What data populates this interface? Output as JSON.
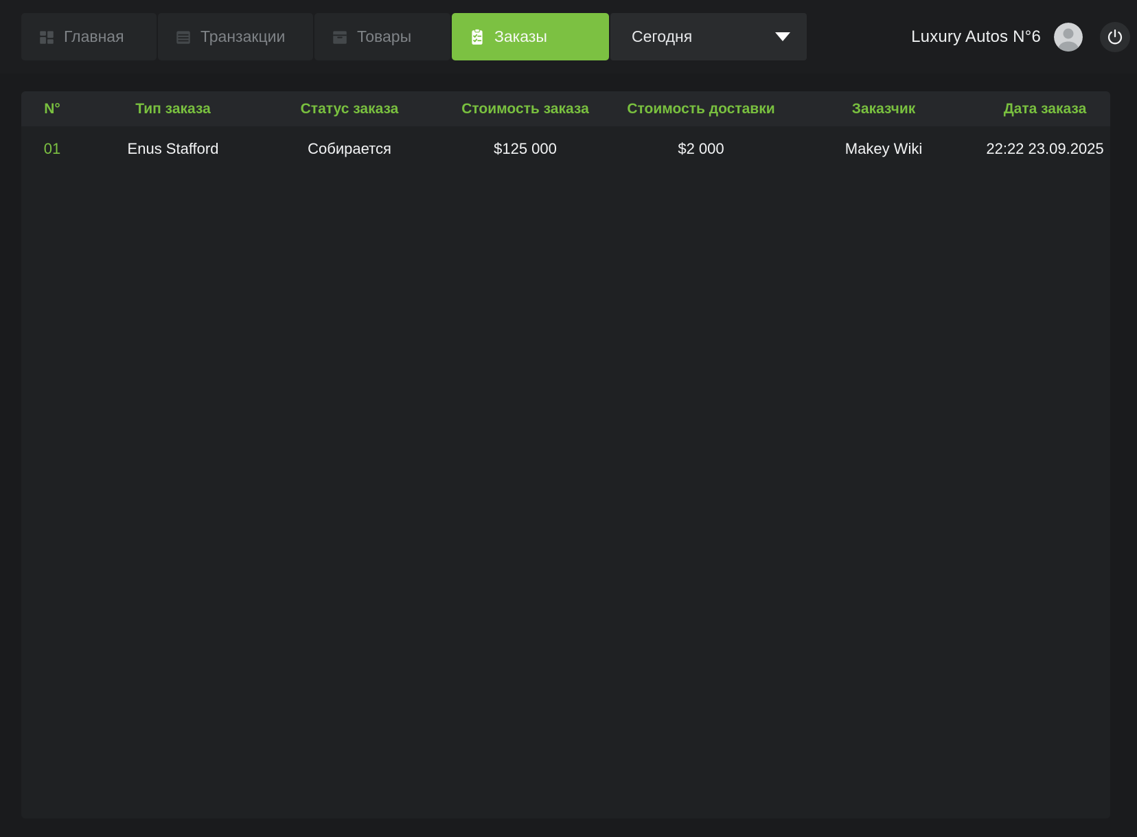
{
  "navbar": {
    "business_name": "Luxury Autos N°6",
    "tabs": [
      {
        "label": "Главная",
        "icon": "dashboard-icon",
        "active": false
      },
      {
        "label": "Транзакции",
        "icon": "transactions-icon",
        "active": false
      },
      {
        "label": "Товары",
        "icon": "goods-box-icon",
        "active": false
      },
      {
        "label": "Заказы",
        "icon": "orders-clipboard-icon",
        "active": true
      }
    ],
    "period_dropdown": {
      "value": "Сегодня",
      "icon": "chevron-down-icon"
    },
    "icons": {
      "avatar": "user-avatar",
      "power": "power-icon"
    }
  },
  "table": {
    "columns": [
      "N°",
      "Тип заказа",
      "Статус заказа",
      "Стоимость заказа",
      "Стоимость доставки",
      "Заказчик",
      "Дата заказа"
    ],
    "rows": [
      {
        "number": "01",
        "order_type": "Enus Stafford",
        "status": "Собирается",
        "order_cost": "$125 000",
        "delivery_cost": "$2 000",
        "customer": "Makey Wiki",
        "date": "22:22 23.09.2025"
      }
    ]
  },
  "colors": {
    "accent_green": "#7cc142",
    "header_text_green": "#79c03f",
    "page_bg": "#1a1b1d",
    "navbar_bg": "#1c1d1f",
    "tab_bg": "#242628",
    "dropdown_bg": "#2a2c2e",
    "panel_bg": "#1f2123",
    "table_header_bg": "#26282b",
    "row_text": "#f3f4f5",
    "inactive_tab_text": "#7f8387"
  }
}
